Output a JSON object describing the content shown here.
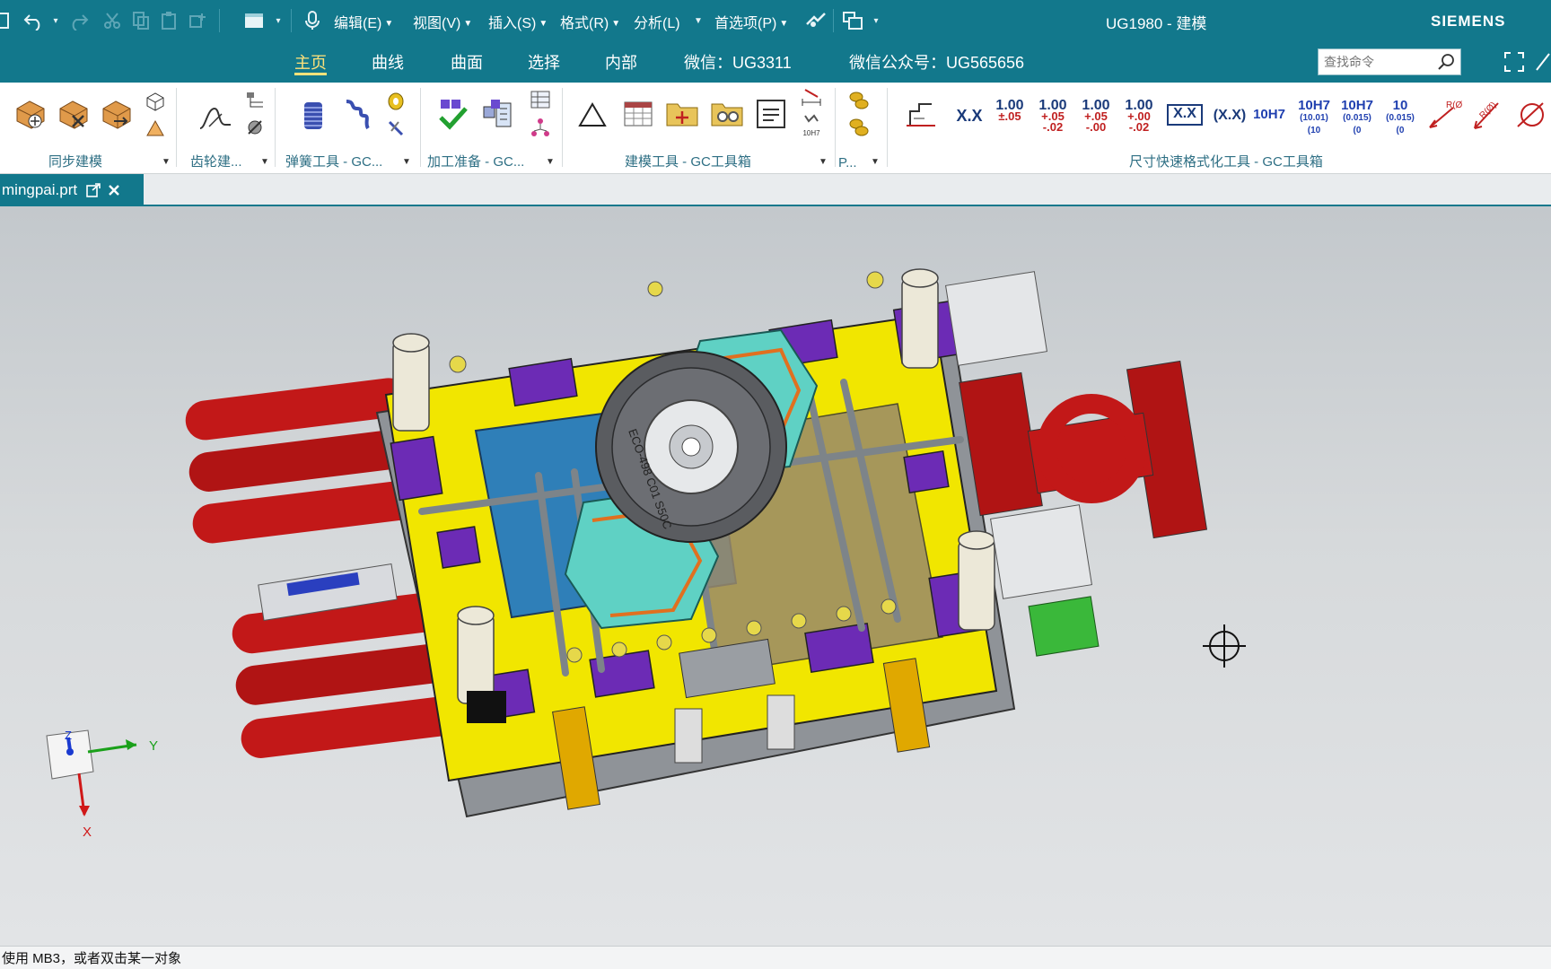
{
  "titlebar": {
    "menus": [
      {
        "label": "编辑(E)"
      },
      {
        "label": "视图(V)"
      },
      {
        "label": "插入(S)"
      },
      {
        "label": "格式(R)"
      },
      {
        "label": "分析(L)"
      },
      {
        "label": "首选项(P)"
      }
    ],
    "window_title": "UG1980 - 建模",
    "brand": "SIEMENS"
  },
  "ribbon_tabs": [
    "主页",
    "曲线",
    "曲面",
    "选择",
    "内部",
    "微信：UG3311",
    "微信公众号：UG565656"
  ],
  "search": {
    "placeholder": "查找命令"
  },
  "groups": {
    "sync": "同步建模",
    "gear": "齿轮建...",
    "spring": "弹簧工具 - GC...",
    "machining": "加工准备 - GC...",
    "modeling": "建模工具 - GC工具箱",
    "p": "P...",
    "dimension": "尺寸快速格式化工具 - GC工具箱"
  },
  "dim_tools": [
    "X.X",
    "1.00 ±.05",
    "1.00 +.05 -.02",
    "1.00 +.05 -.00",
    "1.00 +.00 -.02",
    "X.X",
    "(X.X)",
    "10H7",
    "10H7 (10.01) (10)",
    "10H7 (0.015) (0)",
    "10 (0.015) (0)",
    "R(Ø)",
    "R(Ø)"
  ],
  "dim_small": {
    "plus05": "+.05",
    "minus02": "-.02",
    "minus00": "-.00",
    "plus00": "+.00",
    "pm05": "±.05",
    "one": "1.00"
  },
  "fh_label": "10H7",
  "document_tab": {
    "label": "mingpai.prt"
  },
  "status": {
    "message": "使用 MB3，或者双击某一对象"
  },
  "model_text": {
    "ring": "ECO-498 C01 S50C"
  },
  "triad": {
    "y": "Y",
    "z": "Z",
    "x": "X"
  },
  "colors": {
    "accent": "#12788c",
    "plate": "#f1e600",
    "rod": "#c21818",
    "block": "#6c2bb5",
    "teal": "#5fd1c4"
  }
}
